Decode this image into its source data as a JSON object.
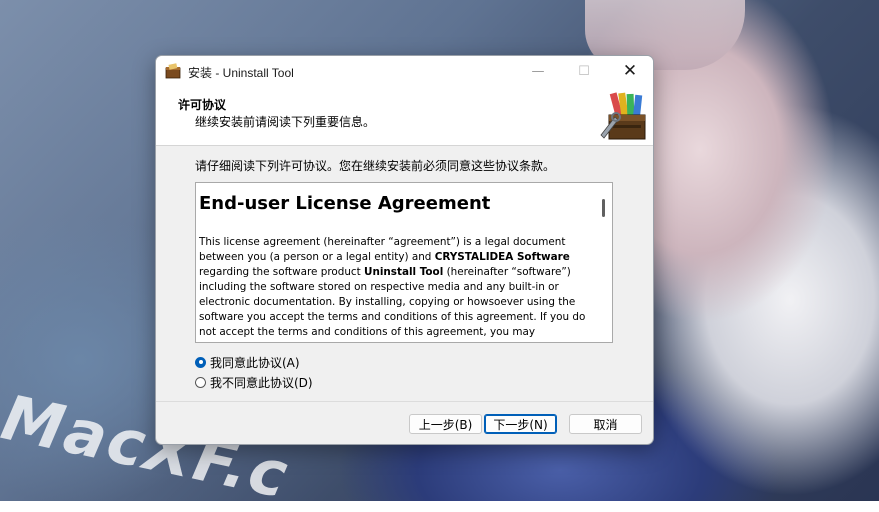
{
  "window": {
    "title": "安装 - Uninstall Tool",
    "controls": {
      "minimize": "—",
      "maximize": "☐",
      "close": "✕"
    }
  },
  "header": {
    "title": "许可协议",
    "subtitle": "继续安装前请阅读下列重要信息。"
  },
  "body": {
    "intro": "请仔细阅读下列许可协议。您在继续安装前必须同意这些协议条款。",
    "license": {
      "heading": "End-user License Agreement",
      "p_start": "This license agreement (hereinafter “agreement”) is a legal document between you (a person or a legal entity) and ",
      "company": "CRYSTALIDEA Software",
      "p_mid": " regarding the software product ",
      "product": "Uninstall Tool",
      "p_end": " (hereinafter “software”) including the software stored on respective media and any built-in or electronic documentation. By installing, copying or howsoever using the software you accept the terms and conditions of this agreement. If you do not accept the terms and conditions of this agreement, you may"
    }
  },
  "options": {
    "accept": "我同意此协议(A)",
    "decline": "我不同意此协议(D)",
    "selected": "accept"
  },
  "buttons": {
    "back": "上一步(B)",
    "next": "下一步(N)",
    "cancel": "取消"
  },
  "desktop": {
    "watermark": "MacXF.c"
  },
  "colors": {
    "accent": "#005fb8",
    "window_bg": "#f0f0f0"
  }
}
